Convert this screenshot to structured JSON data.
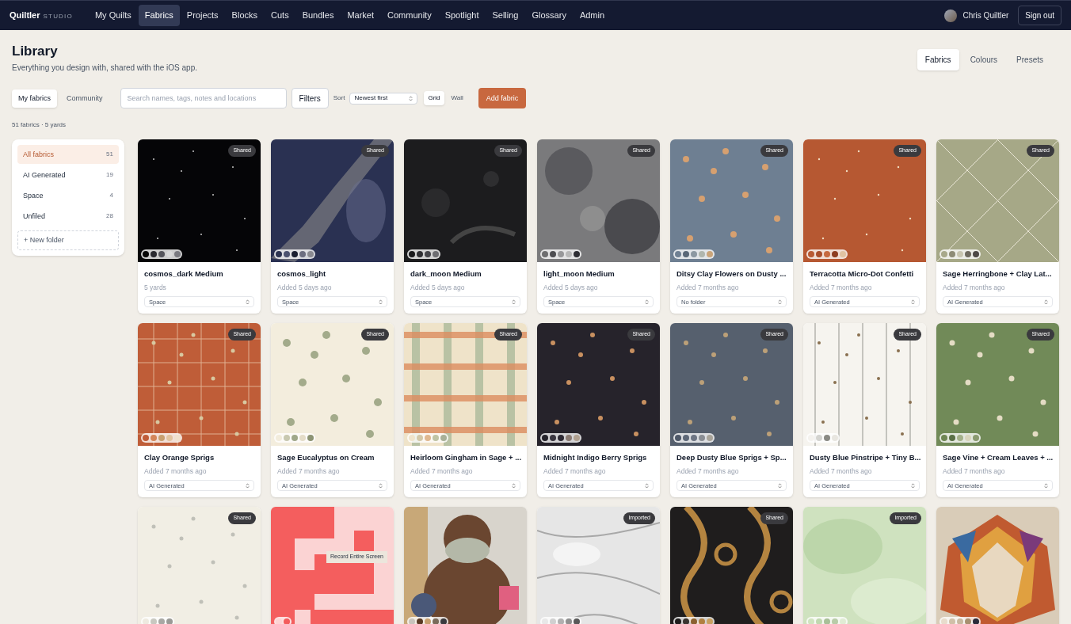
{
  "nav": {
    "logo": "Quiltler",
    "logo_suffix": "STUDIO",
    "items": [
      {
        "label": "My Quilts",
        "selected": false
      },
      {
        "label": "Fabrics",
        "selected": true
      },
      {
        "label": "Projects",
        "selected": false
      },
      {
        "label": "Blocks",
        "selected": false
      },
      {
        "label": "Cuts",
        "selected": false
      },
      {
        "label": "Bundles",
        "selected": false
      },
      {
        "label": "Market",
        "selected": false
      },
      {
        "label": "Community",
        "selected": false
      },
      {
        "label": "Spotlight",
        "selected": false
      },
      {
        "label": "Selling",
        "selected": false
      },
      {
        "label": "Glossary",
        "selected": false
      },
      {
        "label": "Admin",
        "selected": false
      }
    ],
    "user": "Chris Quiltler",
    "sign_out": "Sign out"
  },
  "page": {
    "title": "Library",
    "subtitle": "Everything you design with, shared with the iOS app.",
    "tabs": [
      {
        "label": "Fabrics",
        "selected": true
      },
      {
        "label": "Colours",
        "selected": false
      },
      {
        "label": "Presets",
        "selected": false
      }
    ]
  },
  "toolbar": {
    "scope": [
      {
        "label": "My fabrics",
        "selected": true
      },
      {
        "label": "Community",
        "selected": false
      }
    ],
    "search": {
      "placeholder": "Search names, tags, notes and locations"
    },
    "filters": "Filters",
    "sort_label": "Sort",
    "sort_value": "Newest first",
    "view": [
      {
        "label": "Grid",
        "selected": true
      },
      {
        "label": "Wall",
        "selected": false
      }
    ],
    "add": "Add fabric"
  },
  "summary": "51 fabrics · 5 yards",
  "folders": {
    "items": [
      {
        "name": "All fabrics",
        "count": "51",
        "selected": true
      },
      {
        "name": "AI Generated",
        "count": "19",
        "selected": false
      },
      {
        "name": "Space",
        "count": "4",
        "selected": false
      },
      {
        "name": "Unfiled",
        "count": "28",
        "selected": false
      }
    ],
    "new_folder": "+ New folder"
  },
  "fabrics": [
    {
      "kind": "stars",
      "badge": "Shared",
      "name": "cosmos_dark Medium",
      "subtitle": "5 yards",
      "folder": "Space",
      "swatches": [
        {
          "color": "#050505"
        },
        {
          "color": "#2a2a30"
        },
        {
          "color": "#55555c"
        },
        {
          "color": "#d8d8d8"
        },
        {
          "color": "#7a7a80"
        }
      ]
    },
    {
      "kind": "galaxy",
      "badge": "Shared",
      "name": "cosmos_light",
      "subtitle": "Added 5 days ago",
      "folder": "Space",
      "swatches": [
        {
          "color": "#2c3350"
        },
        {
          "color": "#4d5370"
        },
        {
          "color": "#1a1e30"
        },
        {
          "color": "#6c6e80"
        },
        {
          "color": "#8a8a90"
        }
      ]
    },
    {
      "kind": "moon_dark",
      "badge": "Shared",
      "name": "dark_moon Medium",
      "subtitle": "Added 5 days ago",
      "folder": "Space",
      "swatches": [
        {
          "color": "#1a1a1c"
        },
        {
          "color": "#2e2e32"
        },
        {
          "color": "#45454a"
        },
        {
          "color": "#6e6e72"
        }
      ]
    },
    {
      "kind": "moon_light",
      "badge": "Shared",
      "name": "light_moon Medium",
      "subtitle": "Added 5 days ago",
      "folder": "Space",
      "swatches": [
        {
          "color": "#6e6e70"
        },
        {
          "color": "#4e4e52"
        },
        {
          "color": "#98989a"
        },
        {
          "color": "#b8b8b8"
        },
        {
          "color": "#2e2e34"
        }
      ]
    },
    {
      "kind": "floral_blue",
      "badge": "Shared",
      "name": "Ditsy Clay Flowers on Dusty ...",
      "subtitle": "Added 7 months ago",
      "folder": "No folder",
      "swatches": [
        {
          "color": "#6f8093"
        },
        {
          "color": "#5a6878"
        },
        {
          "color": "#8c98a2"
        },
        {
          "color": "#b0b6ae"
        },
        {
          "color": "#c9a47a"
        }
      ]
    },
    {
      "kind": "dots_orange",
      "badge": "Shared",
      "name": "Terracotta Micro-Dot Confetti",
      "subtitle": "Added 7 months ago",
      "folder": "AI Generated",
      "swatches": [
        {
          "color": "#b85a34"
        },
        {
          "color": "#a84e2c"
        },
        {
          "color": "#c66a40"
        },
        {
          "color": "#8e3e22"
        },
        {
          "color": "#e0c3a2"
        }
      ]
    },
    {
      "kind": "lattice",
      "badge": "Shared",
      "name": "Sage Herringbone + Clay Lat...",
      "subtitle": "Added 7 months ago",
      "folder": "AI Generated",
      "swatches": [
        {
          "color": "#a8a98a"
        },
        {
          "color": "#8e8c76"
        },
        {
          "color": "#c8c6b0"
        },
        {
          "color": "#6e6a5e"
        },
        {
          "color": "#4e4a46"
        }
      ]
    },
    {
      "kind": "grid_orange",
      "badge": "Shared",
      "name": "Clay Orange Sprigs",
      "subtitle": "Added 7 months ago",
      "folder": "AI Generated",
      "swatches": [
        {
          "color": "#c05c38"
        },
        {
          "color": "#d4865a"
        },
        {
          "color": "#c8a070"
        },
        {
          "color": "#e2c4a0"
        },
        {
          "color": "#f0e0cc"
        }
      ]
    },
    {
      "kind": "leaves_cream",
      "badge": "Shared",
      "name": "Sage Eucalyptus on Cream",
      "subtitle": "Added 7 months ago",
      "folder": "AI Generated",
      "swatches": [
        {
          "color": "#f2ecdc"
        },
        {
          "color": "#c8c8b0"
        },
        {
          "color": "#a0a88a"
        },
        {
          "color": "#e4dcc8"
        },
        {
          "color": "#8c9474"
        }
      ]
    },
    {
      "kind": "gingham",
      "badge": "Shared",
      "name": "Heirloom Gingham in Sage + ...",
      "subtitle": "Added 7 months ago",
      "folder": "AI Generated",
      "swatches": [
        {
          "color": "#f0e4cc"
        },
        {
          "color": "#d4c8a8"
        },
        {
          "color": "#e0b890"
        },
        {
          "color": "#c0c4a4"
        },
        {
          "color": "#a8b098"
        }
      ]
    },
    {
      "kind": "floral_dark",
      "badge": "Shared",
      "name": "Midnight Indigo Berry Sprigs",
      "subtitle": "Added 7 months ago",
      "folder": "AI Generated",
      "swatches": [
        {
          "color": "#24222a"
        },
        {
          "color": "#3a3640"
        },
        {
          "color": "#2e2a34"
        },
        {
          "color": "#8a7a72"
        },
        {
          "color": "#b0a090"
        }
      ]
    },
    {
      "kind": "floral_slate",
      "badge": "Shared",
      "name": "Deep Dusty Blue Sprigs + Sp...",
      "subtitle": "Added 7 months ago",
      "folder": "AI Generated",
      "swatches": [
        {
          "color": "#4e5868"
        },
        {
          "color": "#5e6878"
        },
        {
          "color": "#6e7684"
        },
        {
          "color": "#8a8e94"
        },
        {
          "color": "#a8a49a"
        }
      ]
    },
    {
      "kind": "stripes",
      "badge": "Shared",
      "name": "Dusty Blue Pinstripe + Tiny B...",
      "subtitle": "Added 7 months ago",
      "folder": "AI Generated",
      "swatches": [
        {
          "color": "#f4f2ee"
        },
        {
          "color": "#d4d4d0"
        },
        {
          "color": "#8a8a84"
        },
        {
          "color": "#e8e6e0"
        }
      ]
    },
    {
      "kind": "floral_green",
      "badge": "Shared",
      "name": "Sage Vine + Cream Leaves + ...",
      "subtitle": "Added 7 months ago",
      "folder": "AI Generated",
      "swatches": [
        {
          "color": "#6e8654"
        },
        {
          "color": "#5a7046"
        },
        {
          "color": "#a4b08a"
        },
        {
          "color": "#d8d4bc"
        },
        {
          "color": "#8a9a70"
        }
      ]
    },
    {
      "kind": "dots_cream",
      "badge": "Shared",
      "swatches": [
        {
          "color": "#eeeae0"
        },
        {
          "color": "#c8c8c0"
        },
        {
          "color": "#a8a8a4"
        },
        {
          "color": "#9a9a96"
        }
      ]
    },
    {
      "kind": "blocks",
      "tooltip": "Record Entire Screen",
      "swatches": [
        {
          "color": "#fcd4d4"
        },
        {
          "color": "#f45c5c"
        }
      ]
    },
    {
      "swatches": [
        {
          "color": "#c8c4bc"
        },
        {
          "color": "#5a3a24"
        },
        {
          "color": "#c8a070"
        },
        {
          "color": "#7a6a5a"
        },
        {
          "color": "#3a3a3e"
        }
      ]
    },
    {
      "kind": "marble",
      "badge": "Imported",
      "swatches": [
        {
          "color": "#e8e8e8"
        },
        {
          "color": "#d0d0d0"
        },
        {
          "color": "#b0b0b0"
        },
        {
          "color": "#909090"
        },
        {
          "color": "#585858"
        }
      ]
    },
    {
      "kind": "scroll",
      "badge": "Shared",
      "swatches": [
        {
          "color": "#1e1c1c"
        },
        {
          "color": "#3a3430"
        },
        {
          "color": "#8a6030"
        },
        {
          "color": "#b08040"
        },
        {
          "color": "#c8a060"
        }
      ]
    },
    {
      "kind": "wash",
      "badge": "Imported",
      "swatches": [
        {
          "color": "#d0e4c0"
        },
        {
          "color": "#c0d8b0"
        },
        {
          "color": "#a8c098"
        },
        {
          "color": "#b8cca8"
        },
        {
          "color": "#e0ecd4"
        }
      ]
    },
    {
      "kind": "lion",
      "swatches": [
        {
          "color": "#e8dccc"
        },
        {
          "color": "#d0c0a8"
        },
        {
          "color": "#c8b8a0"
        },
        {
          "color": "#a89070"
        },
        {
          "color": "#2a2a3a"
        }
      ]
    }
  ]
}
